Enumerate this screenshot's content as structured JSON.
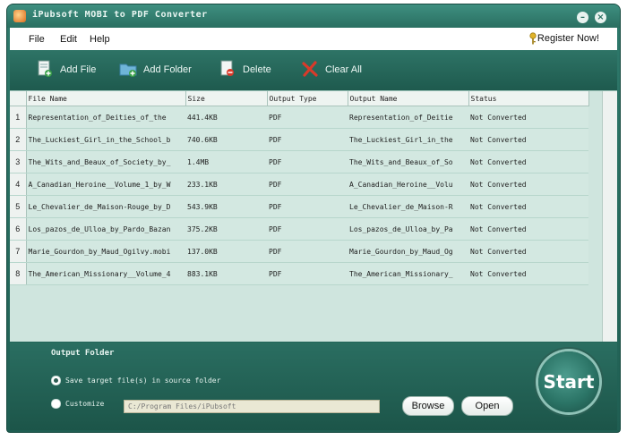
{
  "window": {
    "title": "iPubsoft MOBI to PDF Converter",
    "minimize_glyph": "–",
    "close_glyph": "×"
  },
  "menu": {
    "items": [
      "File",
      "Edit",
      "Help"
    ],
    "register_label": "Register Now!"
  },
  "toolbar": {
    "add_file": "Add File",
    "add_folder": "Add Folder",
    "delete": "Delete",
    "clear_all": "Clear All"
  },
  "table": {
    "headers": [
      "File Name",
      "Size",
      "Output Type",
      "Output Name",
      "Status"
    ],
    "rows": [
      {
        "num": "1",
        "file": "Representation_of_Deities_of_the",
        "size": "441.4KB",
        "type": "PDF",
        "out": "Representation_of_Deitie",
        "status": "Not Converted"
      },
      {
        "num": "2",
        "file": "The_Luckiest_Girl_in_the_School_b",
        "size": "740.6KB",
        "type": "PDF",
        "out": "The_Luckiest_Girl_in_the",
        "status": "Not Converted"
      },
      {
        "num": "3",
        "file": "The_Wits_and_Beaux_of_Society_by_",
        "size": "1.4MB",
        "type": "PDF",
        "out": "The_Wits_and_Beaux_of_So",
        "status": "Not Converted"
      },
      {
        "num": "4",
        "file": "A_Canadian_Heroine__Volume_1_by_W",
        "size": "233.1KB",
        "type": "PDF",
        "out": "A_Canadian_Heroine__Volu",
        "status": "Not Converted"
      },
      {
        "num": "5",
        "file": "Le_Chevalier_de_Maison-Rouge_by_D",
        "size": "543.9KB",
        "type": "PDF",
        "out": "Le_Chevalier_de_Maison-R",
        "status": "Not Converted"
      },
      {
        "num": "6",
        "file": "Los_pazos_de_Ulloa_by_Pardo_Bazan",
        "size": "375.2KB",
        "type": "PDF",
        "out": "Los_pazos_de_Ulloa_by_Pa",
        "status": "Not Converted"
      },
      {
        "num": "7",
        "file": "Marie_Gourdon_by_Maud_Ogilvy.mobi",
        "size": "137.0KB",
        "type": "PDF",
        "out": "Marie_Gourdon_by_Maud_Og",
        "status": "Not Converted"
      },
      {
        "num": "8",
        "file": "The_American_Missionary__Volume_4",
        "size": "883.1KB",
        "type": "PDF",
        "out": "The_American_Missionary_",
        "status": "Not Converted"
      }
    ]
  },
  "output": {
    "section_label": "Output Folder",
    "option_source": "Save target file(s) in source folder",
    "option_customize": "Customize",
    "path_value": "C:/Program Files/iPubsoft",
    "browse_label": "Browse",
    "open_label": "Open",
    "start_label": "Start",
    "selected_option": "source"
  },
  "colors": {
    "window_green": "#2a6f61",
    "table_bg": "#cfe5de",
    "delete_red": "#d93a2a"
  }
}
